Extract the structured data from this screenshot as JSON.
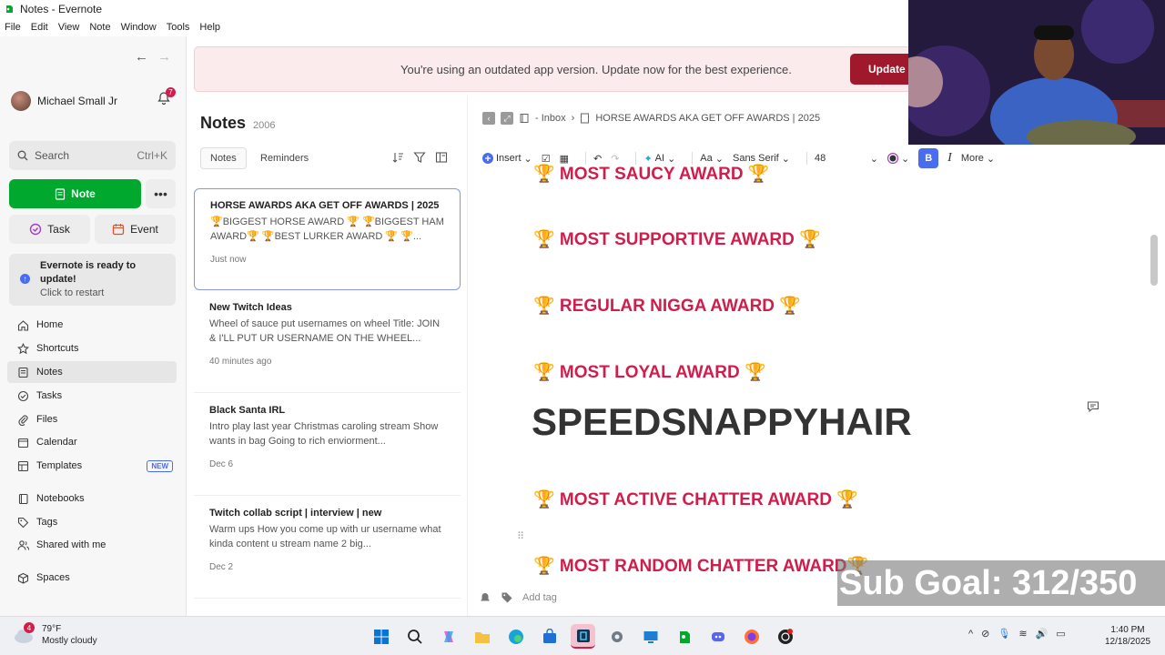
{
  "window": {
    "title": "Notes - Evernote"
  },
  "menu": [
    "File",
    "Edit",
    "View",
    "Note",
    "Window",
    "Tools",
    "Help"
  ],
  "sidebar": {
    "user_name": "Michael Small Jr",
    "notification_count": "7",
    "search_placeholder": "Search",
    "search_shortcut": "Ctrl+K",
    "note_button": "Note",
    "task_button": "Task",
    "event_button": "Event",
    "update_title": "Evernote is ready to update!",
    "update_sub": "Click to restart",
    "nav": [
      {
        "label": "Home",
        "icon": "home-icon"
      },
      {
        "label": "Shortcuts",
        "icon": "star-icon"
      },
      {
        "label": "Notes",
        "icon": "notes-icon"
      },
      {
        "label": "Tasks",
        "icon": "check-circle-icon"
      },
      {
        "label": "Files",
        "icon": "paperclip-icon"
      },
      {
        "label": "Calendar",
        "icon": "calendar-icon"
      },
      {
        "label": "Templates",
        "icon": "template-icon",
        "badge": "NEW"
      },
      {
        "label": "Notebooks",
        "icon": "notebook-icon"
      },
      {
        "label": "Tags",
        "icon": "tag-icon"
      },
      {
        "label": "Shared with me",
        "icon": "shared-icon"
      },
      {
        "label": "Spaces",
        "icon": "cube-icon"
      }
    ]
  },
  "banner": {
    "message": "You're using an outdated app version. Update now for the best experience.",
    "button": "Update"
  },
  "notes_list": {
    "title": "Notes",
    "count": "2006",
    "tabs": [
      "Notes",
      "Reminders"
    ],
    "items": [
      {
        "title": "HORSE AWARDS AKA GET OFF AWARDS | 2025",
        "snippet": "🏆BIGGEST HORSE AWARD 🏆 🏆BIGGEST HAM AWARD🏆 🏆BEST LURKER AWARD 🏆 🏆...",
        "date": "Just now"
      },
      {
        "title": "New Twitch Ideas",
        "snippet": "Wheel of sauce put usernames on wheel Title: JOIN & I'LL PUT UR USERNAME ON THE WHEEL...",
        "date": "40 minutes ago"
      },
      {
        "title": "Black Santa IRL",
        "snippet": "Intro play last year Christmas caroling stream Show wants in bag Going to rich enviorment...",
        "date": "Dec 6"
      },
      {
        "title": "Twitch collab script | interview | new",
        "snippet": "Warm ups How you come up with ur username what kinda content u stream name 2 big...",
        "date": "Dec 2"
      }
    ]
  },
  "editor": {
    "breadcrumb_notebook": "- Inbox",
    "breadcrumb_note": "HORSE AWARDS AKA GET OFF AWARDS | 2025",
    "toolbar": {
      "insert": "Insert",
      "ai": "AI",
      "font_menu": "Aa",
      "font": "Sans Serif",
      "size": "48",
      "bold": "B",
      "italic": "I",
      "more": "More"
    },
    "lines": [
      "🏆 MOST SAUCY AWARD 🏆",
      "🏆 MOST SUPPORTIVE AWARD 🏆",
      "🏆 REGULAR NIGGA AWARD 🏆",
      "🏆 MOST LOYAL AWARD 🏆",
      "🏆 MOST ACTIVE CHATTER AWARD 🏆",
      "🏆 MOST RANDOM CHATTER AWARD🏆"
    ],
    "heading": "SPEEDSNAPPYHAIR",
    "add_tag": "Add tag"
  },
  "overlay": {
    "sub_goal": "Sub Goal: 312/350"
  },
  "taskbar": {
    "temp": "79°F",
    "condition": "Mostly cloudy",
    "weather_badge": "4",
    "time": "1:40 PM",
    "date": "12/18/2025"
  },
  "colors": {
    "accent_green": "#00a82d",
    "award_red": "#d11d4b",
    "update_red": "#a0182c",
    "bold_blue": "#4a6cf0"
  }
}
